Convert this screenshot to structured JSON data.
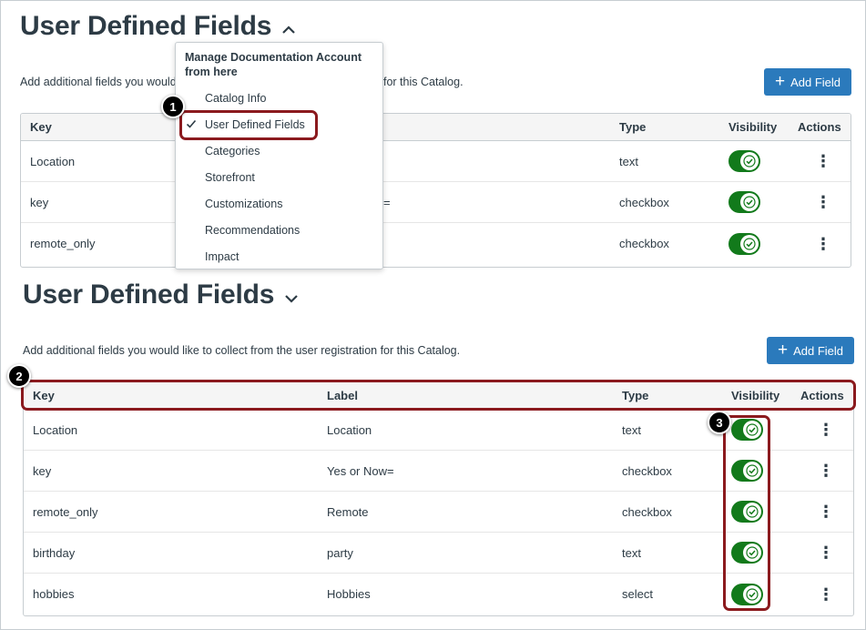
{
  "top": {
    "title": "User Defined Fields",
    "description": "Add additional fields you would like to collect from the user registration for this Catalog.",
    "description_left": "Add additional fields you would",
    "description_right": "for this Catalog.",
    "add_field_label": "Add Field",
    "headers": {
      "key": "Key",
      "type": "Type",
      "visibility": "Visibility",
      "actions": "Actions"
    },
    "rows": [
      {
        "key": "Location",
        "label_fragment": "",
        "type": "text",
        "visible": true
      },
      {
        "key": "key",
        "label_fragment": "=",
        "type": "checkbox",
        "visible": true
      },
      {
        "key": "remote_only",
        "label_fragment": "",
        "type": "checkbox",
        "visible": true
      }
    ]
  },
  "menu": {
    "heading": "Manage Documentation Account from here",
    "items": [
      {
        "label": "Catalog Info",
        "selected": false
      },
      {
        "label": "User Defined Fields",
        "selected": true
      },
      {
        "label": "Categories",
        "selected": false
      },
      {
        "label": "Storefront",
        "selected": false
      },
      {
        "label": "Customizations",
        "selected": false
      },
      {
        "label": "Recommendations",
        "selected": false
      },
      {
        "label": "Impact",
        "selected": false
      }
    ]
  },
  "bottom": {
    "title": "User Defined Fields",
    "description": "Add additional fields you would like to collect from the user registration for this Catalog.",
    "add_field_label": "Add Field",
    "headers": {
      "key": "Key",
      "label": "Label",
      "type": "Type",
      "visibility": "Visibility",
      "actions": "Actions"
    },
    "rows": [
      {
        "key": "Location",
        "label": "Location",
        "type": "text",
        "visible": true
      },
      {
        "key": "key",
        "label": "Yes or Now=",
        "type": "checkbox",
        "visible": true
      },
      {
        "key": "remote_only",
        "label": "Remote",
        "type": "checkbox",
        "visible": true
      },
      {
        "key": "birthday",
        "label": "party",
        "type": "text",
        "visible": true
      },
      {
        "key": "hobbies",
        "label": "Hobbies",
        "type": "select",
        "visible": true
      }
    ]
  },
  "callouts": {
    "one": "1",
    "two": "2",
    "three": "3"
  },
  "colors": {
    "primary_button": "#2b7abc",
    "toggle_on": "#127a1b",
    "highlight": "#8b1a1e",
    "text": "#2d3b45"
  },
  "icons": {
    "expand": "chevron-up-icon",
    "collapse": "chevron-down-icon",
    "add": "plus-icon",
    "toggle": "check-icon",
    "actions": "kebab-icon",
    "selected": "checkmark-icon"
  }
}
